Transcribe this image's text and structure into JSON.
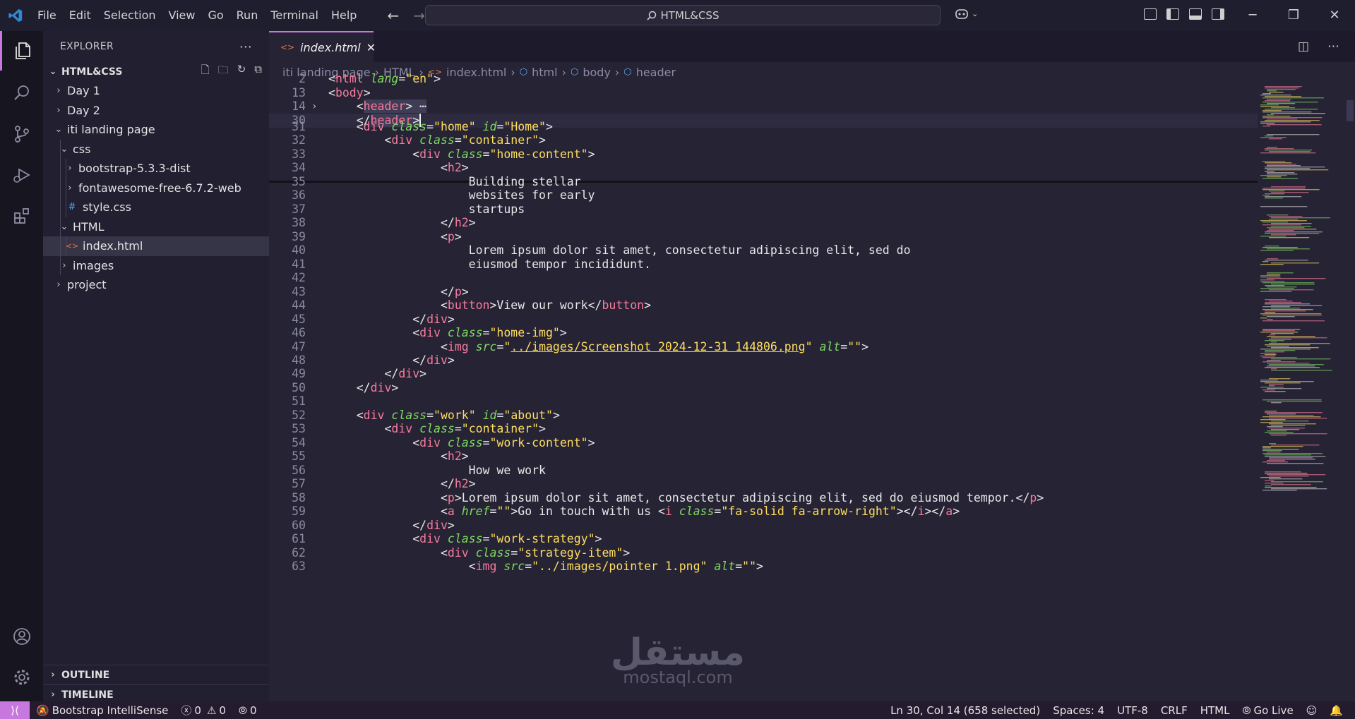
{
  "menu": [
    "File",
    "Edit",
    "Selection",
    "View",
    "Go",
    "Run",
    "Terminal",
    "Help"
  ],
  "command_center": "HTML&CSS",
  "sidebar": {
    "title": "EXPLORER",
    "folder": "HTML&CSS",
    "tree": [
      {
        "label": "Day 1"
      },
      {
        "label": "Day 2"
      },
      {
        "label": "iti landing page"
      },
      {
        "label": "css"
      },
      {
        "label": "bootstrap-5.3.3-dist"
      },
      {
        "label": "fontawesome-free-6.7.2-web"
      },
      {
        "label": "style.css",
        "icon": "#"
      },
      {
        "label": "HTML"
      },
      {
        "label": "index.html"
      },
      {
        "label": "images"
      },
      {
        "label": "project"
      }
    ],
    "outline": "OUTLINE",
    "timeline": "TIMELINE"
  },
  "tab": {
    "label": "index.html",
    "close": "✕"
  },
  "breadcrumb": [
    "iti landing page",
    "HTML",
    "index.html",
    "html",
    "body",
    "header"
  ],
  "code_lines": [
    {
      "n": "2",
      "tokens": [
        [
          "pu",
          "<"
        ],
        [
          "t",
          "html"
        ],
        [
          "pu",
          " "
        ],
        [
          "a",
          "lang"
        ],
        [
          "pu",
          "="
        ],
        [
          "s",
          "\"en\""
        ],
        [
          "pu",
          ">"
        ]
      ]
    },
    {
      "n": "13",
      "tokens": [
        [
          "pu",
          "<"
        ],
        [
          "t",
          "body"
        ],
        [
          "pu",
          ">"
        ]
      ]
    },
    {
      "n": "14",
      "tokens": [
        [
          "pu",
          "    <"
        ],
        [
          "t",
          "header"
        ],
        [
          "pu",
          "> ⋯"
        ]
      ]
    },
    {
      "n": "30",
      "tokens": [
        [
          "pu",
          "    </"
        ],
        [
          "t",
          "header"
        ],
        [
          "pu",
          ">"
        ]
      ]
    },
    {
      "n": "31",
      "tokens": [
        [
          "pu",
          "    <"
        ],
        [
          "t",
          "div"
        ],
        [
          "pu",
          " "
        ],
        [
          "a",
          "class"
        ],
        [
          "pu",
          "="
        ],
        [
          "s",
          "\"home\""
        ],
        [
          "pu",
          " "
        ],
        [
          "a",
          "id"
        ],
        [
          "pu",
          "="
        ],
        [
          "s",
          "\"Home\""
        ],
        [
          "pu",
          ">"
        ]
      ]
    },
    {
      "n": "32",
      "tokens": [
        [
          "pu",
          "        <"
        ],
        [
          "t",
          "div"
        ],
        [
          "pu",
          " "
        ],
        [
          "a",
          "class"
        ],
        [
          "pu",
          "="
        ],
        [
          "s",
          "\"container\""
        ],
        [
          "pu",
          ">"
        ]
      ]
    },
    {
      "n": "33",
      "tokens": [
        [
          "pu",
          "            <"
        ],
        [
          "t",
          "div"
        ],
        [
          "pu",
          " "
        ],
        [
          "a",
          "class"
        ],
        [
          "pu",
          "="
        ],
        [
          "s",
          "\"home-content\""
        ],
        [
          "pu",
          ">"
        ]
      ]
    },
    {
      "n": "34",
      "tokens": [
        [
          "pu",
          "                <"
        ],
        [
          "t",
          "h2"
        ],
        [
          "pu",
          ">"
        ]
      ]
    },
    {
      "n": "35",
      "tokens": [
        [
          "pu",
          "                    Building stellar"
        ]
      ]
    },
    {
      "n": "36",
      "tokens": [
        [
          "pu",
          "                    websites for early"
        ]
      ]
    },
    {
      "n": "37",
      "tokens": [
        [
          "pu",
          "                    startups"
        ]
      ]
    },
    {
      "n": "38",
      "tokens": [
        [
          "pu",
          "                </"
        ],
        [
          "t",
          "h2"
        ],
        [
          "pu",
          ">"
        ]
      ]
    },
    {
      "n": "39",
      "tokens": [
        [
          "pu",
          "                <"
        ],
        [
          "t",
          "p"
        ],
        [
          "pu",
          ">"
        ]
      ]
    },
    {
      "n": "40",
      "tokens": [
        [
          "pu",
          "                    Lorem ipsum dolor sit amet, consectetur adipiscing elit, sed do"
        ]
      ]
    },
    {
      "n": "41",
      "tokens": [
        [
          "pu",
          "                    eiusmod tempor incididunt."
        ]
      ]
    },
    {
      "n": "42",
      "tokens": [
        [
          "pu",
          ""
        ]
      ]
    },
    {
      "n": "43",
      "tokens": [
        [
          "pu",
          "                </"
        ],
        [
          "t",
          "p"
        ],
        [
          "pu",
          ">"
        ]
      ]
    },
    {
      "n": "44",
      "tokens": [
        [
          "pu",
          "                <"
        ],
        [
          "t",
          "button"
        ],
        [
          "pu",
          ">View our work</"
        ],
        [
          "t",
          "button"
        ],
        [
          "pu",
          ">"
        ]
      ]
    },
    {
      "n": "45",
      "tokens": [
        [
          "pu",
          "            </"
        ],
        [
          "t",
          "div"
        ],
        [
          "pu",
          ">"
        ]
      ]
    },
    {
      "n": "46",
      "tokens": [
        [
          "pu",
          "            <"
        ],
        [
          "t",
          "div"
        ],
        [
          "pu",
          " "
        ],
        [
          "a",
          "class"
        ],
        [
          "pu",
          "="
        ],
        [
          "s",
          "\"home-img\""
        ],
        [
          "pu",
          ">"
        ]
      ]
    },
    {
      "n": "47",
      "tokens": [
        [
          "pu",
          "                <"
        ],
        [
          "t",
          "img"
        ],
        [
          "pu",
          " "
        ],
        [
          "a",
          "src"
        ],
        [
          "pu",
          "="
        ],
        [
          "s",
          "\""
        ],
        [
          "su",
          "../images/Screenshot 2024-12-31 144806.png"
        ],
        [
          "s",
          "\""
        ],
        [
          "pu",
          " "
        ],
        [
          "a",
          "alt"
        ],
        [
          "pu",
          "="
        ],
        [
          "s",
          "\"\""
        ],
        [
          "pu",
          ">"
        ]
      ]
    },
    {
      "n": "48",
      "tokens": [
        [
          "pu",
          "            </"
        ],
        [
          "t",
          "div"
        ],
        [
          "pu",
          ">"
        ]
      ]
    },
    {
      "n": "49",
      "tokens": [
        [
          "pu",
          "        </"
        ],
        [
          "t",
          "div"
        ],
        [
          "pu",
          ">"
        ]
      ]
    },
    {
      "n": "50",
      "tokens": [
        [
          "pu",
          "    </"
        ],
        [
          "t",
          "div"
        ],
        [
          "pu",
          ">"
        ]
      ]
    },
    {
      "n": "51",
      "tokens": [
        [
          "pu",
          ""
        ]
      ]
    },
    {
      "n": "52",
      "tokens": [
        [
          "pu",
          "    <"
        ],
        [
          "t",
          "div"
        ],
        [
          "pu",
          " "
        ],
        [
          "a",
          "class"
        ],
        [
          "pu",
          "="
        ],
        [
          "s",
          "\"work\""
        ],
        [
          "pu",
          " "
        ],
        [
          "a",
          "id"
        ],
        [
          "pu",
          "="
        ],
        [
          "s",
          "\"about\""
        ],
        [
          "pu",
          ">"
        ]
      ]
    },
    {
      "n": "53",
      "tokens": [
        [
          "pu",
          "        <"
        ],
        [
          "t",
          "div"
        ],
        [
          "pu",
          " "
        ],
        [
          "a",
          "class"
        ],
        [
          "pu",
          "="
        ],
        [
          "s",
          "\"container\""
        ],
        [
          "pu",
          ">"
        ]
      ]
    },
    {
      "n": "54",
      "tokens": [
        [
          "pu",
          "            <"
        ],
        [
          "t",
          "div"
        ],
        [
          "pu",
          " "
        ],
        [
          "a",
          "class"
        ],
        [
          "pu",
          "="
        ],
        [
          "s",
          "\"work-content\""
        ],
        [
          "pu",
          ">"
        ]
      ]
    },
    {
      "n": "55",
      "tokens": [
        [
          "pu",
          "                <"
        ],
        [
          "t",
          "h2"
        ],
        [
          "pu",
          ">"
        ]
      ]
    },
    {
      "n": "56",
      "tokens": [
        [
          "pu",
          "                    How we work"
        ]
      ]
    },
    {
      "n": "57",
      "tokens": [
        [
          "pu",
          "                </"
        ],
        [
          "t",
          "h2"
        ],
        [
          "pu",
          ">"
        ]
      ]
    },
    {
      "n": "58",
      "tokens": [
        [
          "pu",
          "                <"
        ],
        [
          "t",
          "p"
        ],
        [
          "pu",
          ">Lorem ipsum dolor sit amet, consectetur adipiscing elit, sed do eiusmod tempor.</"
        ],
        [
          "t",
          "p"
        ],
        [
          "pu",
          ">"
        ]
      ]
    },
    {
      "n": "59",
      "tokens": [
        [
          "pu",
          "                <"
        ],
        [
          "t",
          "a"
        ],
        [
          "pu",
          " "
        ],
        [
          "a",
          "href"
        ],
        [
          "pu",
          "="
        ],
        [
          "s",
          "\"\""
        ],
        [
          "pu",
          ">Go in touch with us <"
        ],
        [
          "t",
          "i"
        ],
        [
          "pu",
          " "
        ],
        [
          "a",
          "class"
        ],
        [
          "pu",
          "="
        ],
        [
          "s",
          "\"fa-solid fa-arrow-right\""
        ],
        [
          "pu",
          "></"
        ],
        [
          "t",
          "i"
        ],
        [
          "pu",
          "></"
        ],
        [
          "t",
          "a"
        ],
        [
          "pu",
          ">"
        ]
      ]
    },
    {
      "n": "60",
      "tokens": [
        [
          "pu",
          "            </"
        ],
        [
          "t",
          "div"
        ],
        [
          "pu",
          ">"
        ]
      ]
    },
    {
      "n": "61",
      "tokens": [
        [
          "pu",
          "            <"
        ],
        [
          "t",
          "div"
        ],
        [
          "pu",
          " "
        ],
        [
          "a",
          "class"
        ],
        [
          "pu",
          "="
        ],
        [
          "s",
          "\"work-strategy\""
        ],
        [
          "pu",
          ">"
        ]
      ]
    },
    {
      "n": "62",
      "tokens": [
        [
          "pu",
          "                <"
        ],
        [
          "t",
          "div"
        ],
        [
          "pu",
          " "
        ],
        [
          "a",
          "class"
        ],
        [
          "pu",
          "="
        ],
        [
          "s",
          "\"strategy-item\""
        ],
        [
          "pu",
          ">"
        ]
      ]
    },
    {
      "n": "63",
      "tokens": [
        [
          "pu",
          "                    <"
        ],
        [
          "t",
          "img"
        ],
        [
          "pu",
          " "
        ],
        [
          "a",
          "src"
        ],
        [
          "pu",
          "="
        ],
        [
          "s",
          "\"../images/pointer 1.png\""
        ],
        [
          "pu",
          " "
        ],
        [
          "a",
          "alt"
        ],
        [
          "pu",
          "="
        ],
        [
          "s",
          "\"\""
        ],
        [
          "pu",
          ">"
        ]
      ]
    }
  ],
  "status": {
    "intellisense": "Bootstrap IntelliSense",
    "errors": "0",
    "warnings": "0",
    "ports": "0",
    "position": "Ln 30, Col 14 (658 selected)",
    "spaces": "Spaces: 4",
    "encoding": "UTF-8",
    "eol": "CRLF",
    "language": "HTML",
    "golive": "Go Live"
  },
  "watermark": {
    "arabic": "مستقل",
    "latin": "mostaql.com"
  },
  "colors": {
    "accent": "#c678dd",
    "tag": "#f97b9c",
    "attr": "#7fd962",
    "string": "#fede5d"
  }
}
